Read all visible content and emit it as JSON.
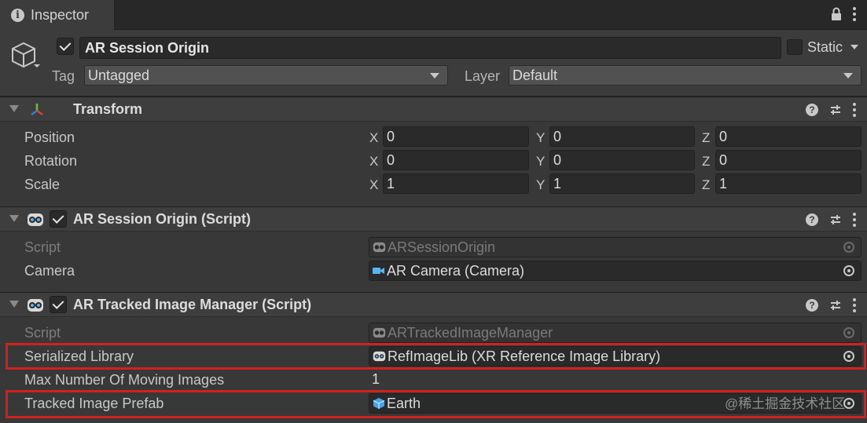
{
  "window": {
    "tab_title": "Inspector",
    "icons": [
      "info-icon",
      "lock-icon",
      "kebab-menu-icon"
    ]
  },
  "gameobject": {
    "active": true,
    "name": "AR Session Origin",
    "static_label": "Static",
    "static_checked": false,
    "tag_label": "Tag",
    "tag_value": "Untagged",
    "layer_label": "Layer",
    "layer_value": "Default"
  },
  "transform": {
    "title": "Transform",
    "rows": [
      {
        "label": "Position",
        "x": "0",
        "y": "0",
        "z": "0"
      },
      {
        "label": "Rotation",
        "x": "0",
        "y": "0",
        "z": "0"
      },
      {
        "label": "Scale",
        "x": "1",
        "y": "1",
        "z": "1"
      }
    ],
    "axes": [
      "X",
      "Y",
      "Z"
    ]
  },
  "session_origin": {
    "title": "AR Session Origin (Script)",
    "enabled": true,
    "script_label": "Script",
    "script_value": "ARSessionOrigin",
    "camera_label": "Camera",
    "camera_value": "AR Camera (Camera)"
  },
  "image_manager": {
    "title": "AR Tracked Image Manager (Script)",
    "enabled": true,
    "script_label": "Script",
    "script_value": "ARTrackedImageManager",
    "library_label": "Serialized Library",
    "library_value": "RefImageLib (XR Reference Image Library)",
    "max_label": "Max Number Of Moving Images",
    "max_value": "1",
    "prefab_label": "Tracked Image Prefab",
    "prefab_value": "Earth"
  },
  "colors": {
    "background": "#383838",
    "highlight": "#d21f1f"
  },
  "watermark": "@稀土掘金技术社区"
}
